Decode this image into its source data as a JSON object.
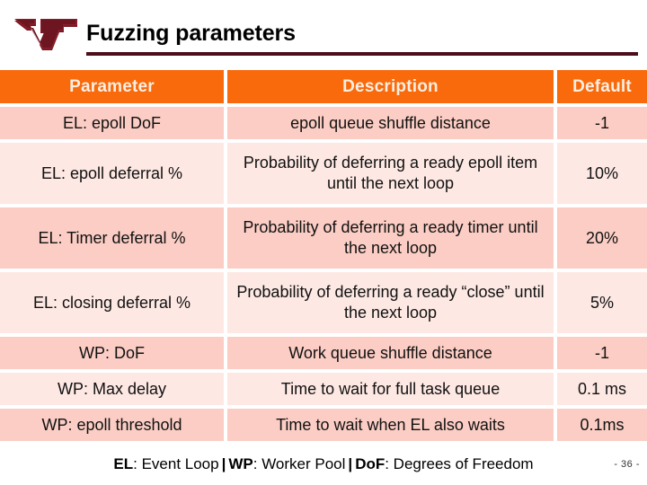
{
  "slide": {
    "title": "Fuzzing parameters",
    "logo_alt": "vt-logo",
    "number": "- 36 -",
    "accent_orange": "#F86A0B",
    "row_shade_dark": "#FBCDC4",
    "row_shade_light": "#FDE8E3",
    "rule_color": "#4D0D1A"
  },
  "table": {
    "headers": {
      "parameter": "Parameter",
      "description": "Description",
      "default": "Default"
    },
    "rows": [
      {
        "parameter": "EL: epoll DoF",
        "description": "epoll queue shuffle distance",
        "default": "-1"
      },
      {
        "parameter": "EL: epoll deferral %",
        "description": "Probability of deferring a ready epoll item until the next loop",
        "default": "10%"
      },
      {
        "parameter": "EL: Timer deferral %",
        "description": "Probability of deferring a ready timer until the next loop",
        "default": "20%"
      },
      {
        "parameter": "EL: closing deferral %",
        "description": "Probability of deferring a ready “close” until the next loop",
        "default": "5%"
      },
      {
        "parameter": "WP: DoF",
        "description": "Work queue shuffle distance",
        "default": "-1"
      },
      {
        "parameter": "WP: Max delay",
        "description": "Time to wait for full task queue",
        "default": "0.1 ms"
      },
      {
        "parameter": "WP: epoll threshold",
        "description": "Time to wait when EL also waits",
        "default": "0.1ms"
      }
    ]
  },
  "footer": {
    "el_abbr": "EL",
    "el_text": ": Event Loop",
    "sep1": "|",
    "wp_abbr": "WP",
    "wp_text": ": Worker Pool",
    "sep2": "|",
    "dof_abbr": "DoF",
    "dof_text": ": Degrees of Freedom"
  }
}
